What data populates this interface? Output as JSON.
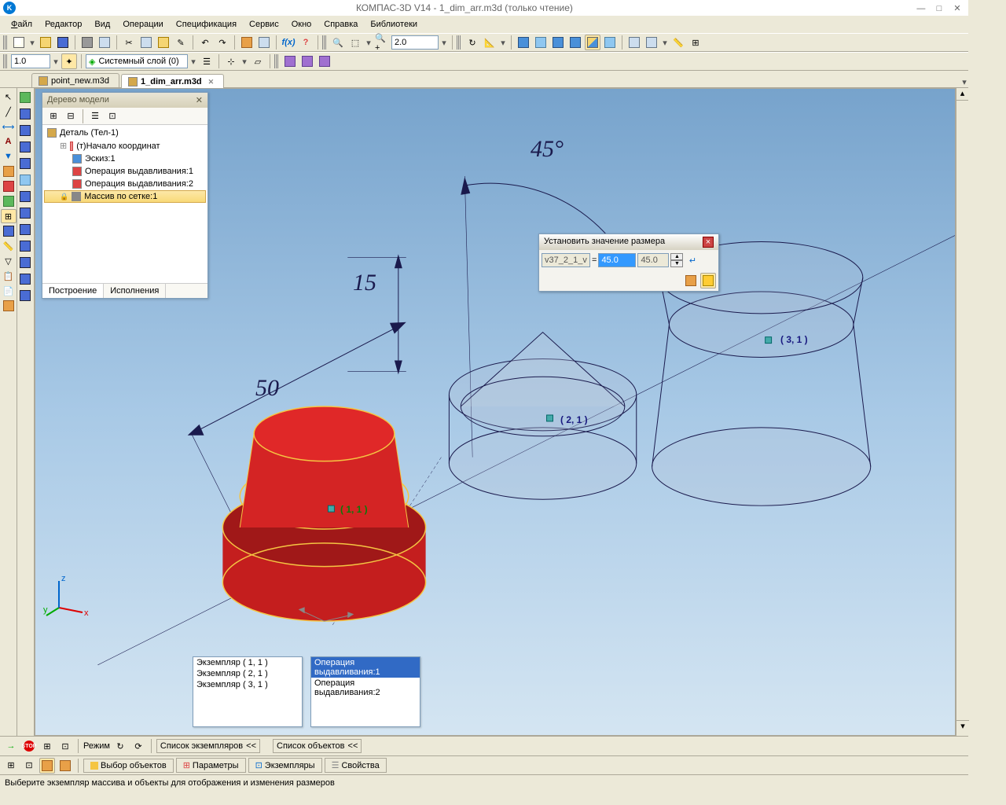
{
  "app": {
    "title": "КОМПАС-3D V14 - 1_dim_arr.m3d (только чтение)",
    "icon_letter": "K"
  },
  "menu": {
    "file": "Файл",
    "edit": "Редактор",
    "view": "Вид",
    "ops": "Операции",
    "spec": "Спецификация",
    "service": "Сервис",
    "window": "Окно",
    "help": "Справка",
    "libs": "Библиотеки"
  },
  "toolbar": {
    "scale": "1.0",
    "layer": "Системный слой (0)",
    "zoom": "2.0"
  },
  "tabs": {
    "t1": "point_new.m3d",
    "t2": "1_dim_arr.m3d"
  },
  "tree": {
    "title": "Дерево модели",
    "root": "Деталь (Тел-1)",
    "coord": "(т)Начало координат",
    "sketch": "Эскиз:1",
    "ext1": "Операция выдавливания:1",
    "ext2": "Операция выдавливания:2",
    "array": "Массив по сетке:1",
    "tab_build": "Построение",
    "tab_exec": "Исполнения"
  },
  "dims": {
    "angle": "45°",
    "h": "15",
    "d": "50"
  },
  "coords": {
    "c1": "( 1, 1 )",
    "c2": "( 2, 1 )",
    "c3": "( 3, 1 )"
  },
  "dialog": {
    "title": "Установить значение размера",
    "varname": "v37_2_1_v",
    "eq": "=",
    "val": "45.0",
    "prev": "45.0"
  },
  "lists": {
    "ex1": "Экземпляр ( 1, 1 )",
    "ex2": "Экземпляр ( 2, 1 )",
    "ex3": "Экземпляр ( 3, 1 )",
    "obj1": "Операция выдавливания:1",
    "obj2": "Операция выдавливания:2",
    "lbl_ex": "Список экземпляров",
    "lbl_obj": "Список объектов"
  },
  "bottom": {
    "mode": "Режим",
    "tab1": "Выбор объектов",
    "tab2": "Параметры",
    "tab3": "Экземпляры",
    "tab4": "Свойства"
  },
  "status": "Выберите экземпляр массива и объекты для отображения и изменения размеров",
  "axes": {
    "x": "x",
    "y": "y",
    "z": "z"
  }
}
